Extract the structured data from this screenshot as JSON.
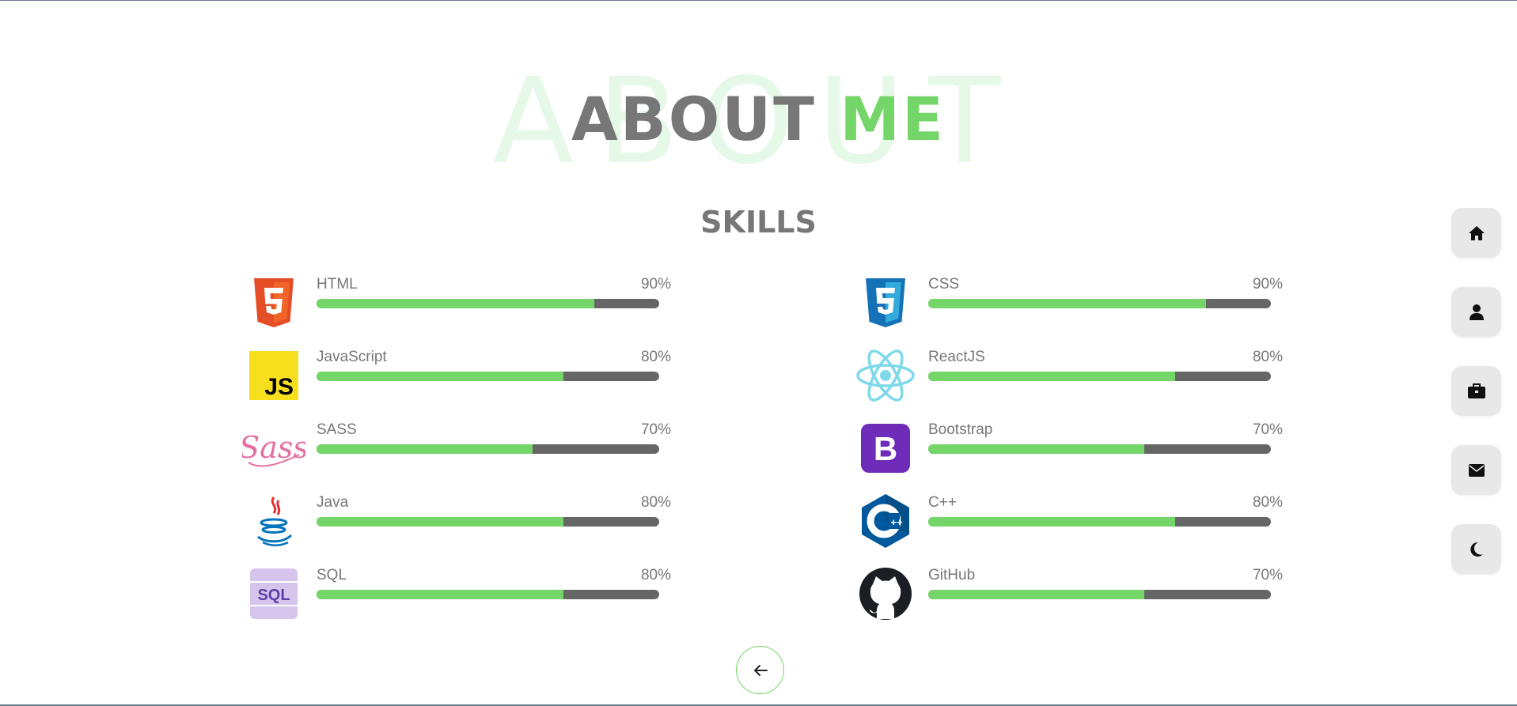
{
  "heading": {
    "background_word": "ABOUT",
    "title_part1": "ABOUT",
    "title_part2": "ME"
  },
  "section": {
    "title": "SKILLS"
  },
  "colors": {
    "accent": "#74d668",
    "bar_track": "#666666",
    "text": "#777777"
  },
  "skills_left": [
    {
      "name": "HTML",
      "percent_label": "90%",
      "level": 0.81,
      "icon": "html5-icon"
    },
    {
      "name": "JavaScript",
      "percent_label": "80%",
      "level": 0.72,
      "icon": "javascript-icon"
    },
    {
      "name": "SASS",
      "percent_label": "70%",
      "level": 0.63,
      "icon": "sass-icon"
    },
    {
      "name": "Java",
      "percent_label": "80%",
      "level": 0.72,
      "icon": "java-icon"
    },
    {
      "name": "SQL",
      "percent_label": "80%",
      "level": 0.72,
      "icon": "sql-icon"
    }
  ],
  "skills_right": [
    {
      "name": "CSS",
      "percent_label": "90%",
      "level": 0.81,
      "icon": "css3-icon"
    },
    {
      "name": "ReactJS",
      "percent_label": "80%",
      "level": 0.72,
      "icon": "react-icon"
    },
    {
      "name": "Bootstrap",
      "percent_label": "70%",
      "level": 0.63,
      "icon": "bootstrap-icon"
    },
    {
      "name": "C++",
      "percent_label": "80%",
      "level": 0.72,
      "icon": "cplusplus-icon"
    },
    {
      "name": "GitHub",
      "percent_label": "70%",
      "level": 0.63,
      "icon": "github-icon"
    }
  ],
  "nav": [
    {
      "icon": "home-icon"
    },
    {
      "icon": "user-icon"
    },
    {
      "icon": "briefcase-icon"
    },
    {
      "icon": "envelope-icon"
    },
    {
      "icon": "moon-icon"
    }
  ],
  "back_button": {
    "icon": "arrow-left-icon"
  }
}
